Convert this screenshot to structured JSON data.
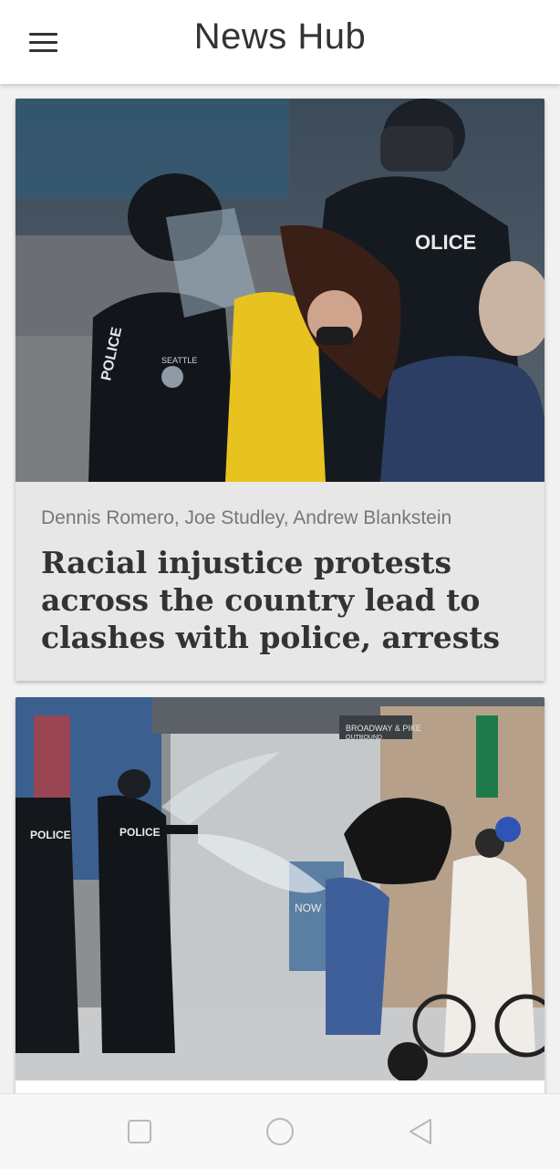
{
  "app": {
    "title": "News Hub"
  },
  "icons": {
    "menu": "menu-icon",
    "recents": "square-icon",
    "home": "circle-icon",
    "back": "triangle-back-icon"
  },
  "articles": [
    {
      "authors": "Dennis Romero, Joe Studley, Andrew Blankstein",
      "headline": "Racial injustice protests across the country lead to clashes with police, arrests",
      "image_labels": [
        "POLICE",
        "SEATTLE POLICE"
      ]
    },
    {
      "authors": "",
      "headline": "",
      "image_labels": [
        "POLICE",
        "POLICE",
        "BROADWAY & PIKE OUTBOUND",
        "NOW"
      ]
    }
  ],
  "colors": {
    "appbar": "#ffffff",
    "card": "#e7e7e7",
    "text": "#333333",
    "meta": "#777777"
  }
}
